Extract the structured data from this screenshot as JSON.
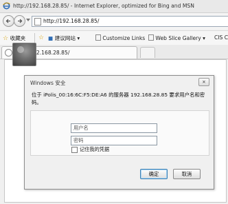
{
  "window": {
    "title": "http://192.168.28.85/ - Internet Explorer, optimized for Bing and MSN"
  },
  "address_bar": {
    "url": "http://192.168.28.85/"
  },
  "favorites_bar": {
    "favorites_label": "收藏夹",
    "suggested_sites": "建议网站 ▾",
    "customize_links": "Customize Links",
    "web_slice_gallery": "Web Slice Gallery ▾",
    "overflow_label": "CIS Cl"
  },
  "tab": {
    "label": "http://192.168.28.85/"
  },
  "dialog": {
    "title": "Windows 安全",
    "message": "位于 iPolis_00:16:6C:F5:DE:A6 的服务器 192.168.28.85 要求用户名和密码。",
    "username_placeholder": "用户名",
    "password_placeholder": "密码",
    "remember_label": "记住我的凭据",
    "ok_button": "确定",
    "cancel_button": "取消"
  }
}
